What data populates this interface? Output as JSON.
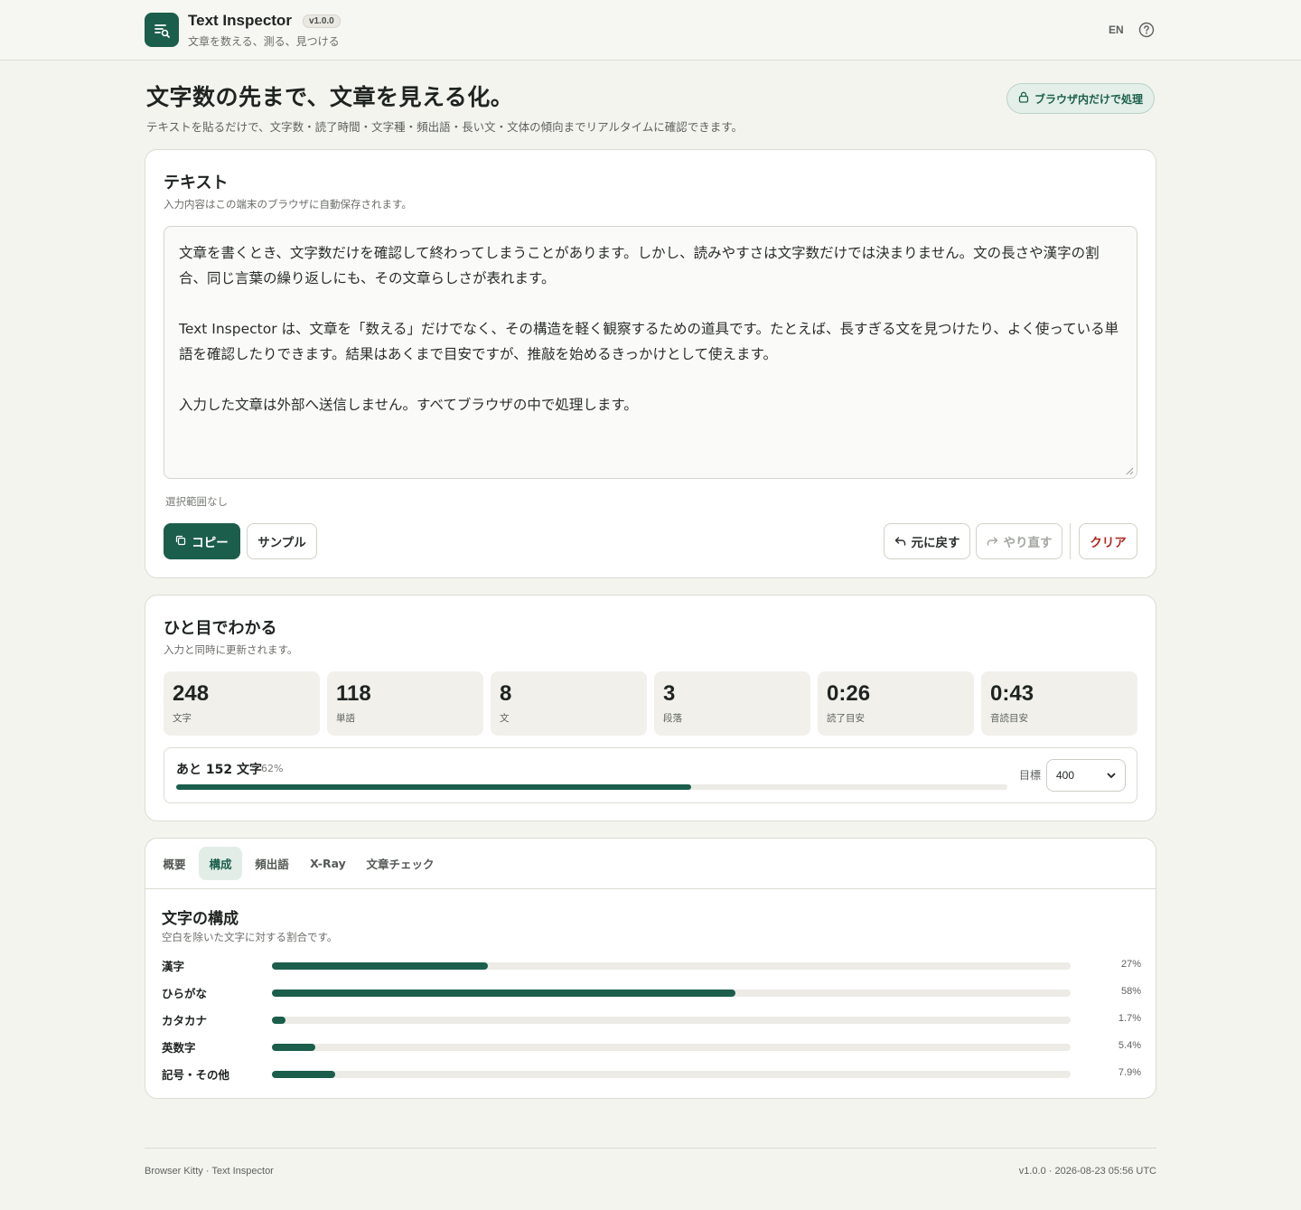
{
  "header": {
    "title": "Text Inspector",
    "version": "v1.0.0",
    "tagline": "文章を数える、測る、見つける",
    "lang": "EN",
    "logo_icon": "text-search-icon",
    "help_icon": "help-circle-icon"
  },
  "hero": {
    "title": "文字数の先まで、文章を見える化。",
    "subtitle": "テキストを貼るだけで、文字数・読了時間・文字種・頻出語・長い文・文体の傾向までリアルタイムに確認できます。",
    "privacy_badge": "ブラウザ内だけで処理",
    "privacy_icon": "lock-icon"
  },
  "editor": {
    "title": "テキスト",
    "description": "入力内容はこの端末のブラウザに自動保存されます。",
    "paragraphs": [
      "文章を書くとき、文字数だけを確認して終わってしまうことがあります。しかし、読みやすさは文字数だけでは決まりません。文の長さや漢字の割合、同じ言葉の繰り返しにも、その文章らしさが表れます。",
      "Text Inspector は、文章を「数える」だけでなく、その構造を軽く観察するための道具です。たとえば、長すぎる文を見つけたり、よく使っている単語を確認したりできます。結果はあくまで目安ですが、推敲を始めるきっかけとして使えます。",
      "入力した文章は外部へ送信しません。すべてブラウザの中で処理します。"
    ],
    "selection_status": "選択範囲なし",
    "buttons": {
      "copy": "コピー",
      "sample": "サンプル",
      "undo": "元に戻す",
      "redo": "やり直す",
      "clear": "クリア"
    }
  },
  "stats": {
    "title": "ひと目でわかる",
    "description": "入力と同時に更新されます。",
    "items": [
      {
        "value": "248",
        "label": "文字"
      },
      {
        "value": "118",
        "label": "単語"
      },
      {
        "value": "8",
        "label": "文"
      },
      {
        "value": "3",
        "label": "段落"
      },
      {
        "value": "0:26",
        "label": "読了目安"
      },
      {
        "value": "0:43",
        "label": "音読目安"
      }
    ],
    "goal": {
      "remaining_text": "あと 152 文字",
      "percent_text": "62%",
      "progress": 0.62,
      "target_label": "目標",
      "target_value": "400"
    }
  },
  "tabs": {
    "items": [
      "概要",
      "構成",
      "頻出語",
      "X-Ray",
      "文章チェック"
    ],
    "active_index": 1
  },
  "composition": {
    "title": "文字の構成",
    "description": "空白を除いた文字に対する割合です。",
    "rows": [
      {
        "label": "漢字",
        "value": "27%",
        "ratio": 0.27
      },
      {
        "label": "ひらがな",
        "value": "58%",
        "ratio": 0.58
      },
      {
        "label": "カタカナ",
        "value": "1.7%",
        "ratio": 0.017
      },
      {
        "label": "英数字",
        "value": "5.4%",
        "ratio": 0.054
      },
      {
        "label": "記号・その他",
        "value": "7.9%",
        "ratio": 0.079
      }
    ]
  },
  "footer": {
    "left": "Browser Kitty · Text Inspector",
    "right": "v1.0.0 · 2026-08-23 05:56 UTC"
  },
  "colors": {
    "accent": "#1b5e4b",
    "danger": "#b3261e",
    "background": "#f4f4ef"
  }
}
